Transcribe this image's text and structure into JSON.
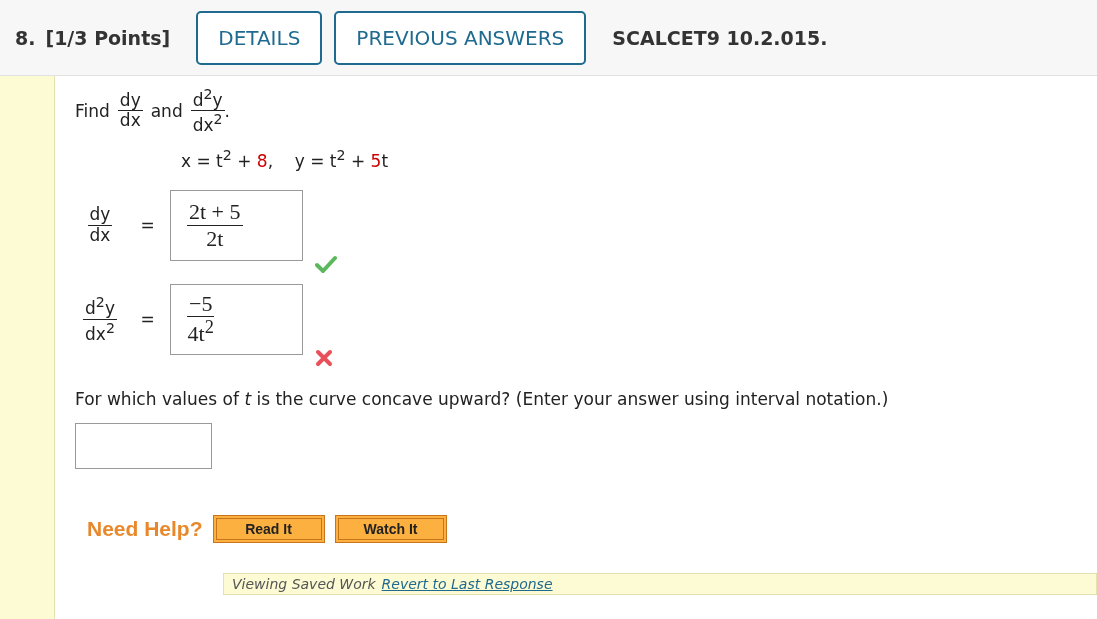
{
  "header": {
    "number": "8.",
    "points": "[1/3 Points]",
    "buttons": [
      "DETAILS",
      "PREVIOUS ANSWERS"
    ],
    "code": "SCALCET9 10.2.015."
  },
  "prompt": {
    "lead": "Find",
    "first": {
      "num": "dy",
      "den": "dx"
    },
    "joiner": "and",
    "second": {
      "num": "d$^{2}$y",
      "den": "dx$^{2}$"
    },
    "end": "."
  },
  "equation": [
    {
      "kind": "plain",
      "text": "x = t$^{2}$ + "
    },
    {
      "kind": "param",
      "text": "8"
    },
    {
      "kind": "plain",
      "text": ",    y = t$^{2}$ + "
    },
    {
      "kind": "param",
      "text": "5"
    },
    {
      "kind": "plain",
      "text": "t"
    }
  ],
  "answers": [
    {
      "label": {
        "num": "dy",
        "den": "dx"
      },
      "equals": "=",
      "answer": {
        "num": "2t + 5",
        "den": "2t"
      },
      "correct": true
    },
    {
      "label": {
        "num": "d$^{2}$y",
        "den": "dx$^{2}$"
      },
      "equals": "=",
      "answer": {
        "num": "−5",
        "den": "4t$^{2}$"
      },
      "correct": false
    }
  ],
  "question": "For which values of *t* is the curve concave upward? (Enter your answer using interval notation.)",
  "help": {
    "title": "Need Help?",
    "buttons": [
      "Read It",
      "Watch It"
    ]
  },
  "saved": {
    "text": "Viewing Saved Work",
    "link": "Revert to Last Response"
  }
}
